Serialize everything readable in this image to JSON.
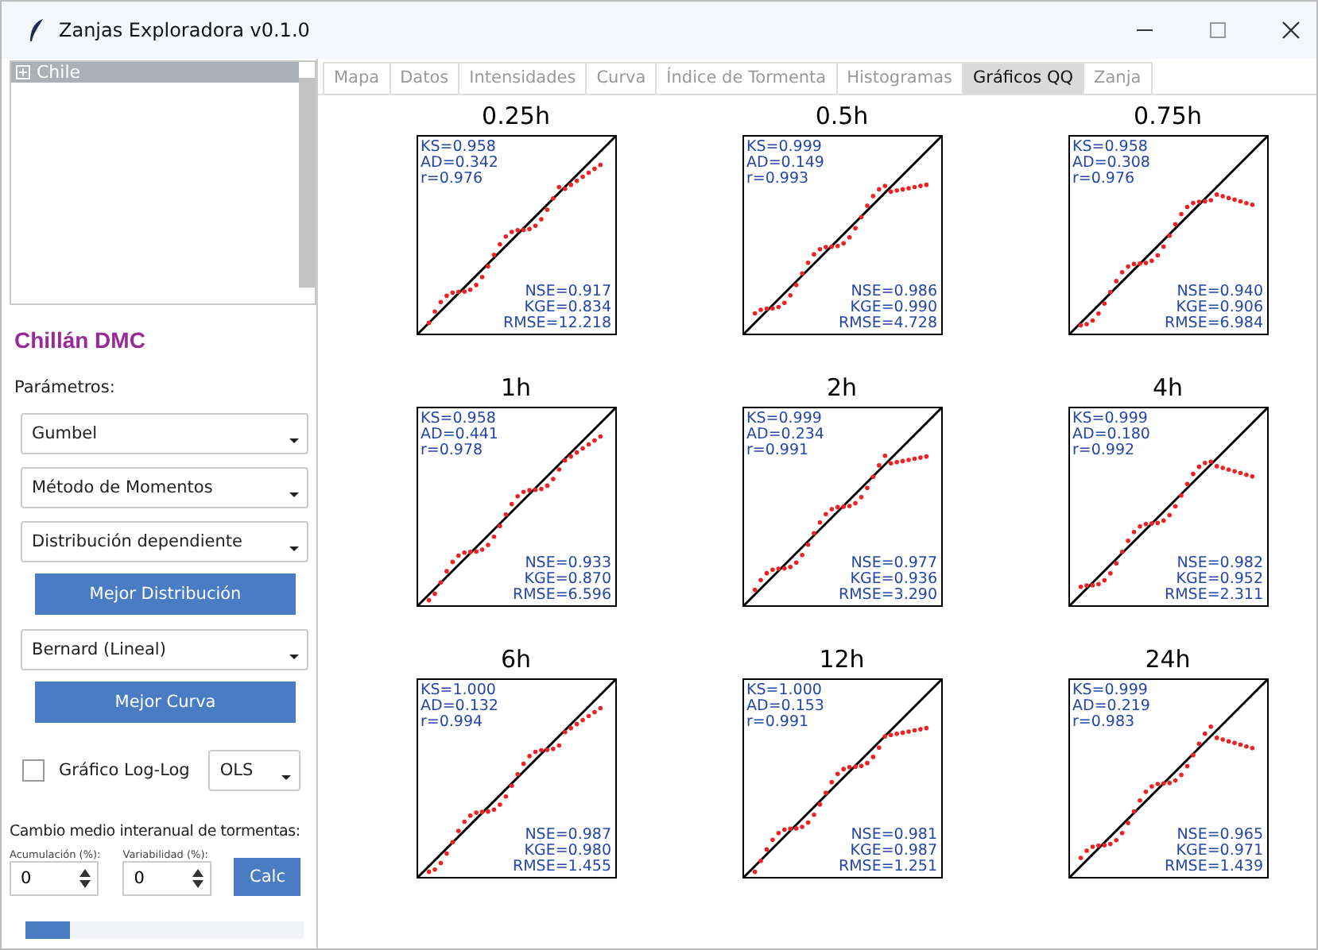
{
  "window": {
    "title": "Zanjas Exploradora v0.1.0"
  },
  "tree": {
    "items": [
      {
        "label": "Chile",
        "expanded": false,
        "selected": true
      }
    ]
  },
  "sidebar": {
    "station": "Chillán DMC",
    "params_label": "Parámetros:",
    "dropdowns": [
      {
        "value": "Gumbel"
      },
      {
        "value": "Método de Momentos"
      },
      {
        "value": "Distribución dependiente"
      }
    ],
    "best_distribution_button": "Mejor Distribución",
    "curve_dropdown": {
      "value": "Bernard (Lineal)"
    },
    "best_curve_button": "Mejor Curva",
    "loglog": {
      "label": "Gráfico Log-Log",
      "checked": false
    },
    "fit_dropdown": {
      "value": "OLS"
    },
    "change_label": "Cambio medio interanual de tormentas:",
    "spinners": [
      {
        "label": "Acumulación (%):",
        "value": "0"
      },
      {
        "label": "Variabilidad (%):",
        "value": "0"
      }
    ],
    "calc_button": "Calc",
    "progress": {
      "level": 0.16
    }
  },
  "tabs": [
    {
      "label": "Mapa",
      "selected": false
    },
    {
      "label": "Datos",
      "selected": false
    },
    {
      "label": "Intensidades",
      "selected": false
    },
    {
      "label": "Curva",
      "selected": false
    },
    {
      "label": "Índice de Tormenta",
      "selected": false
    },
    {
      "label": "Histogramas",
      "selected": false
    },
    {
      "label": "Gráficos QQ",
      "selected": true
    },
    {
      "label": "Zanja",
      "selected": false
    }
  ],
  "plots": [
    {
      "title": "0.25h",
      "stats_left": [
        "KS=0.958",
        "AD=0.342",
        "r=0.976"
      ],
      "stats_right": [
        "NSE=0.917",
        "KGE=0.834",
        "RMSE=12.218"
      ]
    },
    {
      "title": "0.5h",
      "stats_left": [
        "KS=0.999",
        "AD=0.149",
        "r=0.993"
      ],
      "stats_right": [
        "NSE=0.986",
        "KGE=0.990",
        "RMSE=4.728"
      ]
    },
    {
      "title": "0.75h",
      "stats_left": [
        "KS=0.958",
        "AD=0.308",
        "r=0.976"
      ],
      "stats_right": [
        "NSE=0.940",
        "KGE=0.906",
        "RMSE=6.984"
      ]
    },
    {
      "title": "1h",
      "stats_left": [
        "KS=0.958",
        "AD=0.441",
        "r=0.978"
      ],
      "stats_right": [
        "NSE=0.933",
        "KGE=0.870",
        "RMSE=6.596"
      ]
    },
    {
      "title": "2h",
      "stats_left": [
        "KS=0.999",
        "AD=0.234",
        "r=0.991"
      ],
      "stats_right": [
        "NSE=0.977",
        "KGE=0.936",
        "RMSE=3.290"
      ]
    },
    {
      "title": "4h",
      "stats_left": [
        "KS=0.999",
        "AD=0.180",
        "r=0.992"
      ],
      "stats_right": [
        "NSE=0.982",
        "KGE=0.952",
        "RMSE=2.311"
      ]
    },
    {
      "title": "6h",
      "stats_left": [
        "KS=1.000",
        "AD=0.132",
        "r=0.994"
      ],
      "stats_right": [
        "NSE=0.987",
        "KGE=0.980",
        "RMSE=1.455"
      ]
    },
    {
      "title": "12h",
      "stats_left": [
        "KS=1.000",
        "AD=0.153",
        "r=0.991"
      ],
      "stats_right": [
        "NSE=0.981",
        "KGE=0.987",
        "RMSE=1.251"
      ]
    },
    {
      "title": "24h",
      "stats_left": [
        "KS=0.999",
        "AD=0.219",
        "r=0.983"
      ],
      "stats_right": [
        "NSE=0.965",
        "KGE=0.971",
        "RMSE=1.439"
      ]
    }
  ]
}
